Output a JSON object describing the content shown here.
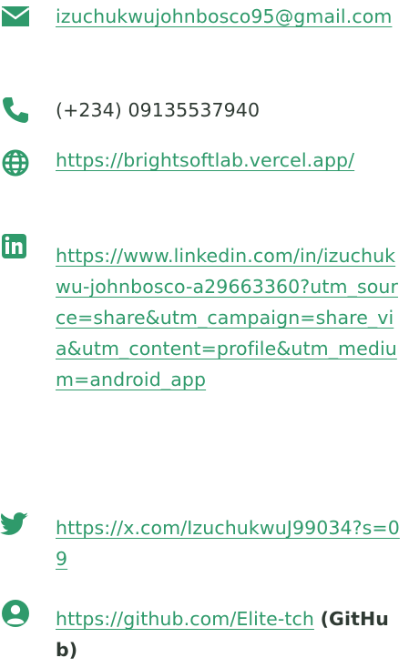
{
  "colors": {
    "icon": "#2f9a6b",
    "link": "#2f9a6b",
    "text": "#2f3a33"
  },
  "contacts": [
    {
      "icon": "envelope-icon",
      "text": "izuchukwujohnbosco95@gmail.com"
    },
    {
      "icon": "phone-icon",
      "text": "(+234) 09135537940"
    },
    {
      "icon": "globe-icon",
      "text": "https://brightsoftlab.vercel.app/"
    },
    {
      "icon": "linkedin-icon",
      "text": "https://www.linkedin.com/in/izuchukwu-johnbosco-a29663360?utm_source=share&utm_campaign=share_via&utm_content=profile&utm_medium=android_app"
    },
    {
      "icon": "twitter-icon",
      "text": "https://x.com/IzuchukwuJ99034?s=09"
    },
    {
      "icon": "user-icon",
      "text": "https://github.com/Elite-tch",
      "suffix": "(GitHub)"
    }
  ]
}
